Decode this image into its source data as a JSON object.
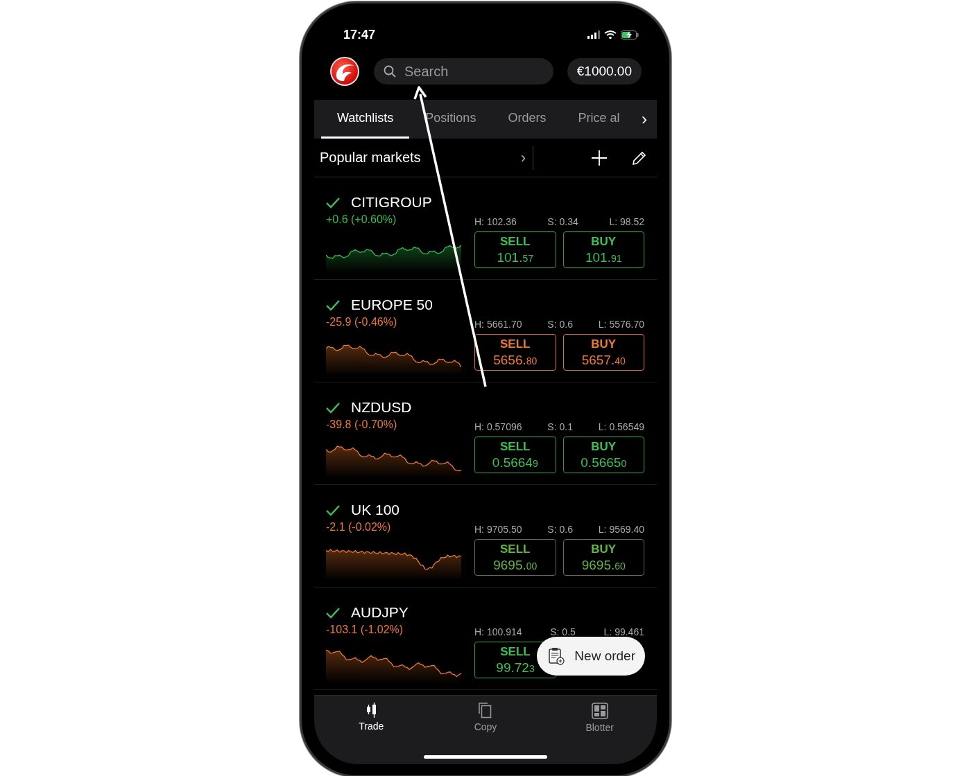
{
  "status_bar": {
    "time": "17:47"
  },
  "header": {
    "search": {
      "placeholder": "Search"
    },
    "balance": "€1000.00"
  },
  "tabs": [
    {
      "label": "Watchlists",
      "selected": true
    },
    {
      "label": "Positions",
      "selected": false
    },
    {
      "label": "Orders",
      "selected": false
    },
    {
      "label": "Price al",
      "selected": false
    }
  ],
  "tabs_more": "›",
  "watchlist": {
    "title": "Popular markets",
    "chevron": "›"
  },
  "markets": [
    {
      "name": "CITIGROUP",
      "change": "+0.6 (+0.60%)",
      "kind": "up",
      "high": "H: 102.36",
      "spread": "S: 0.34",
      "low": "L: 98.52",
      "buttons": [
        {
          "label": "SELL",
          "price": "101.",
          "small": "57",
          "kind": "up"
        },
        {
          "label": "BUY",
          "price": "101.",
          "small": "91",
          "kind": "up"
        }
      ]
    },
    {
      "name": "EUROPE 50",
      "change": "-25.9 (-0.46%)",
      "kind": "down",
      "high": "H: 5661.70",
      "spread": "S: 0.6",
      "low": "L: 5576.70",
      "buttons": [
        {
          "label": "SELL",
          "price": "5656.",
          "small": "80",
          "kind": "down"
        },
        {
          "label": "BUY",
          "price": "5657.",
          "small": "40",
          "kind": "down"
        }
      ]
    },
    {
      "name": "NZDUSD",
      "change": "-39.8 (-0.70%)",
      "kind": "down",
      "high": "H: 0.57096",
      "spread": "S: 0.1",
      "low": "L: 0.56549",
      "buttons": [
        {
          "label": "SELL",
          "price": "0.5664",
          "small": "9",
          "kind": "up"
        },
        {
          "label": "BUY",
          "price": "0.5665",
          "small": "0",
          "kind": "up"
        }
      ]
    },
    {
      "name": "UK 100",
      "change": "-2.1 (-0.02%)",
      "kind": "down",
      "high": "H: 9705.50",
      "spread": "S: 0.6",
      "low": "L: 9569.40",
      "buttons": [
        {
          "label": "SELL",
          "price": "9695.",
          "small": "00",
          "kind": "neutral"
        },
        {
          "label": "BUY",
          "price": "9695.",
          "small": "60",
          "kind": "neutral"
        }
      ]
    },
    {
      "name": "AUDJPY",
      "change": "-103.1 (-1.02%)",
      "kind": "down",
      "high": "H: 100.914",
      "spread": "S: 0.5",
      "low": "L: 99.461",
      "buttons": [
        {
          "label": "SELL",
          "price": "99.72",
          "small": "3",
          "kind": "up"
        }
      ]
    }
  ],
  "fab": {
    "label": "New order"
  },
  "bottom_nav": [
    {
      "label": "Trade",
      "selected": true
    },
    {
      "label": "Copy",
      "selected": false
    },
    {
      "label": "Blotter",
      "selected": false
    }
  ]
}
